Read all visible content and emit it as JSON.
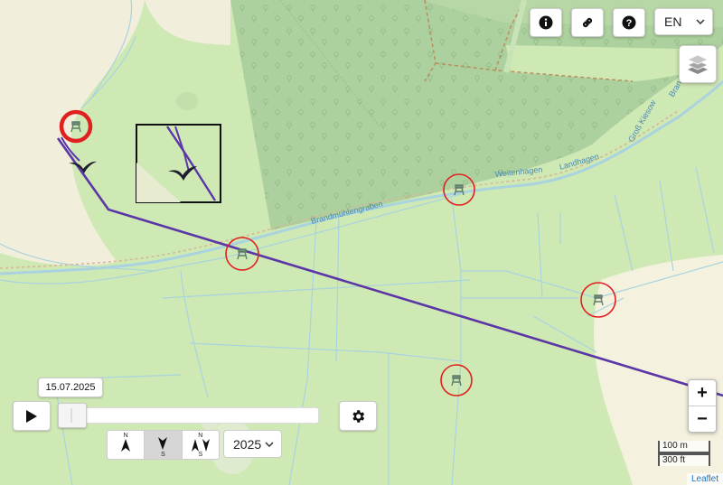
{
  "header": {
    "info_icon": "info-icon",
    "link_icon": "link-icon",
    "help_icon": "help-icon",
    "language": "EN"
  },
  "layers_icon": "layers-icon",
  "map_labels": {
    "stream": "Brandmühlengraben",
    "road1": "Weitenhagen",
    "road2": "Landhagen",
    "road3": "Groß Kiesow",
    "road4": "Brandteich"
  },
  "colors": {
    "track": "#5b36a6",
    "highlight_circle": "#e02020",
    "meadow": "#cfe9b5",
    "forest": "#add19e",
    "field": "#f1eedb",
    "water": "#a9d3de"
  },
  "timeline": {
    "date": "15.07.2025",
    "progress": 0.0,
    "play_icon": "play-icon",
    "settings_icon": "gear-icon"
  },
  "direction_buttons": [
    {
      "letter_top": "N",
      "letter_bottom": "",
      "name": "north-up",
      "selected": false
    },
    {
      "letter_top": "",
      "letter_bottom": "S",
      "name": "heading-up",
      "selected": true
    },
    {
      "letter_top": "N",
      "letter_bottom": "S",
      "name": "both",
      "selected": false
    }
  ],
  "year_select": "2025",
  "zoom": {
    "in": "+",
    "out": "−"
  },
  "scale": {
    "metric": "100 m",
    "imperial": "300 ft"
  },
  "attribution": "Leaflet"
}
